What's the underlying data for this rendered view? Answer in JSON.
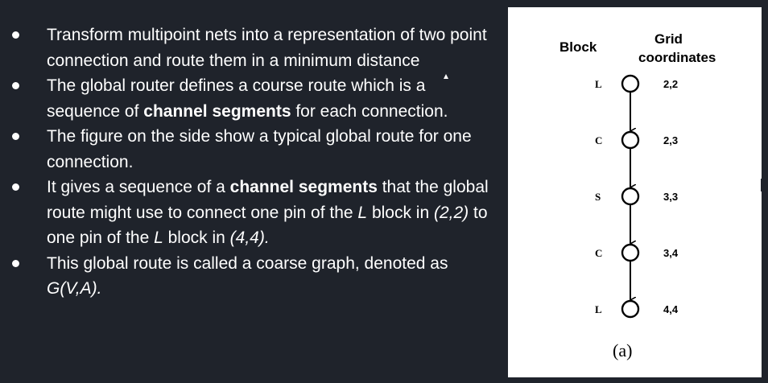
{
  "slide": {
    "bullets": [
      {
        "parts": [
          {
            "text": "Transform multipoint nets into a representation of two point connection and route them in a minimum distance",
            "style": "normal"
          }
        ]
      },
      {
        "parts": [
          {
            "text": "The global router defines a course route which is a sequence of ",
            "style": "normal"
          },
          {
            "text": "channel segments",
            "style": "bold"
          },
          {
            "text": " for each connection.",
            "style": "normal"
          }
        ]
      },
      {
        "parts": [
          {
            "text": "The figure on the side show a typical global route for one connection.",
            "style": "normal"
          }
        ]
      },
      {
        "parts": [
          {
            "text": "It gives a sequence of a ",
            "style": "normal"
          },
          {
            "text": "channel segments",
            "style": "bold"
          },
          {
            "text": " that the global route might use to connect one pin of the ",
            "style": "normal"
          },
          {
            "text": "L",
            "style": "italic"
          },
          {
            "text": " block in ",
            "style": "normal"
          },
          {
            "text": "(2,2)",
            "style": "italic"
          },
          {
            "text": " to one pin of the ",
            "style": "normal"
          },
          {
            "text": "L",
            "style": "italic"
          },
          {
            "text": " block in ",
            "style": "normal"
          },
          {
            "text": "(4,4).",
            "style": "italic"
          }
        ]
      },
      {
        "parts": [
          {
            "text": "This global route is called a coarse graph, denoted as ",
            "style": "normal"
          },
          {
            "text": "G(V,A).",
            "style": "italic"
          }
        ]
      }
    ]
  },
  "figure": {
    "header_block": "Block",
    "header_grid_line1": "Grid",
    "header_grid_line2": "coordinates",
    "caption": "(a)",
    "nodes": [
      {
        "block": "L",
        "coord": "2,2"
      },
      {
        "block": "C",
        "coord": "2,3"
      },
      {
        "block": "S",
        "coord": "3,3"
      },
      {
        "block": "C",
        "coord": "3,4"
      },
      {
        "block": "L",
        "coord": "4,4"
      }
    ]
  }
}
